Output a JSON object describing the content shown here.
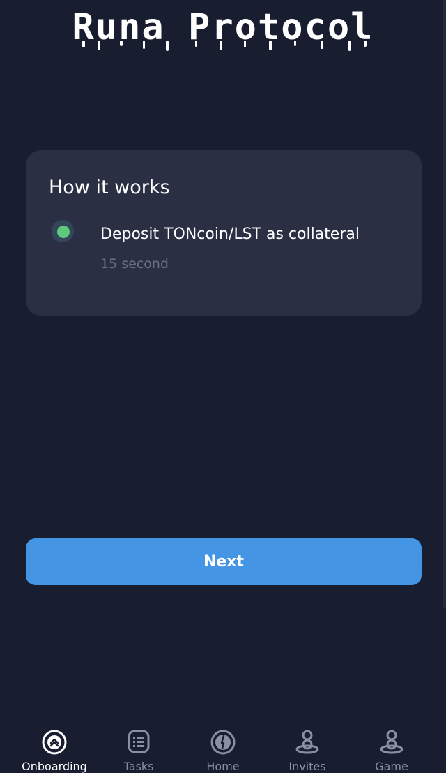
{
  "app": {
    "title": "Runa Protocol"
  },
  "card": {
    "title": "How it works",
    "steps": [
      {
        "label": "Deposit TONcoin/LST as collateral",
        "time": "15 second",
        "status_color": "#5dc97a"
      }
    ]
  },
  "actions": {
    "next_label": "Next"
  },
  "nav": {
    "items": [
      {
        "label": "Onboarding",
        "icon": "onboarding-icon",
        "active": true
      },
      {
        "label": "Tasks",
        "icon": "tasks-icon",
        "active": false
      },
      {
        "label": "Home",
        "icon": "home-icon",
        "active": false
      },
      {
        "label": "Invites",
        "icon": "invites-icon",
        "active": false
      },
      {
        "label": "Game",
        "icon": "game-icon",
        "active": false
      }
    ]
  },
  "colors": {
    "background": "#181d30",
    "card": "#2a2f44",
    "accent": "#4495e3",
    "status_green": "#5dc97a"
  }
}
